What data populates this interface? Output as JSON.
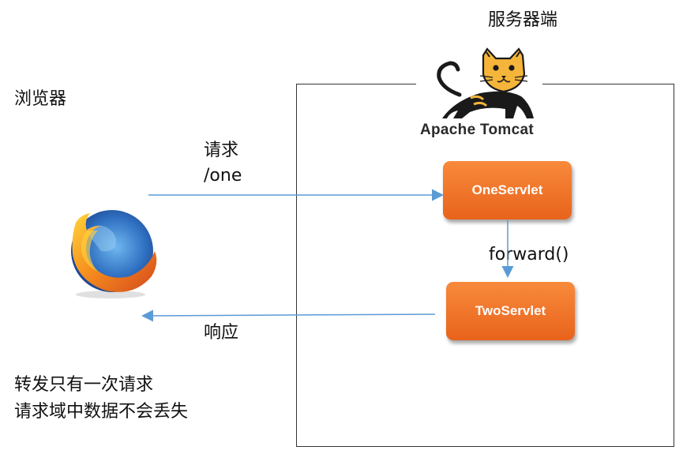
{
  "labels": {
    "server_side": "服务器端",
    "browser": "浏览器",
    "request_line1": "请求",
    "request_line2": "/one",
    "forward": "forward()",
    "response": "响应",
    "note_line1": "转发只有一次请求",
    "note_line2": "请求域中数据不会丢失"
  },
  "logos": {
    "tomcat": {
      "icon": "tomcat-cat-logo",
      "caption": "Apache Tomcat"
    },
    "browser": {
      "icon": "firefox-logo"
    }
  },
  "nodes": {
    "servlet_one": "OneServlet",
    "servlet_two": "TwoServlet"
  },
  "colors": {
    "servlet_fill": "#f07a2c",
    "arrow": "#5b9bd5",
    "box_border": "#333333"
  }
}
